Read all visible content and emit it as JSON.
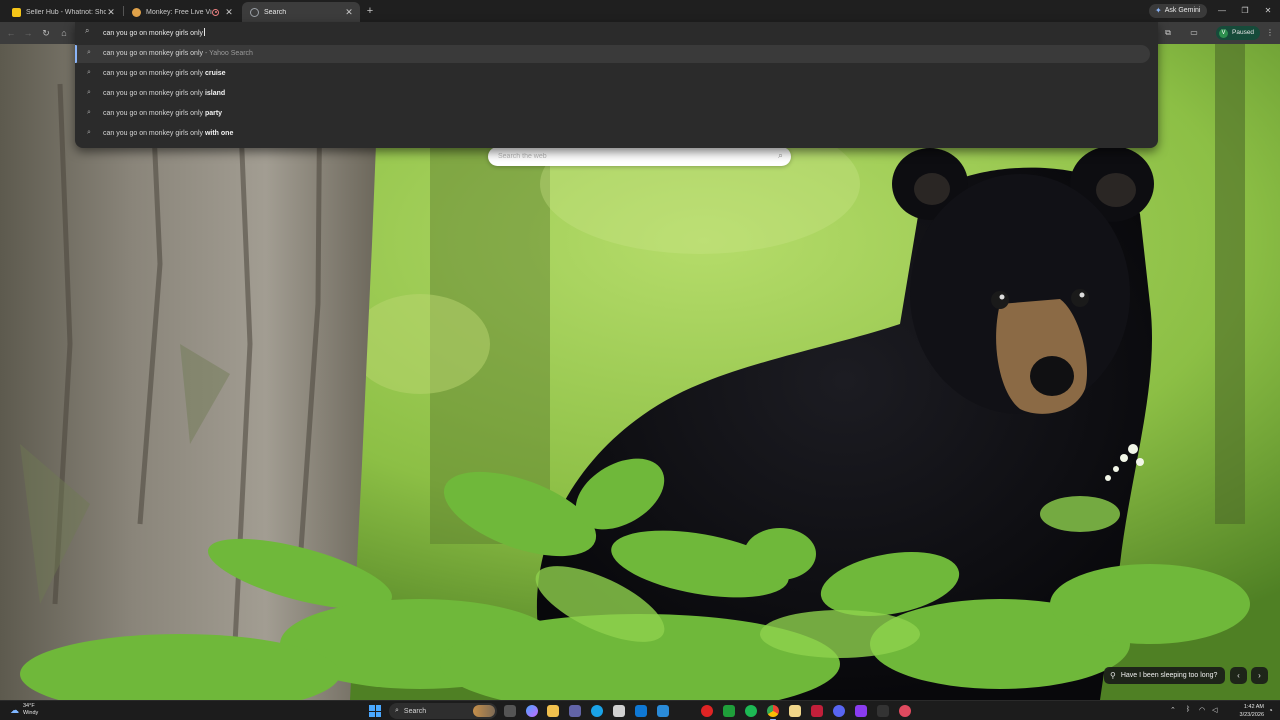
{
  "browser": {
    "tabs": [
      {
        "title": "Seller Hub - Whatnot: Shop, Sell",
        "favicon": "whatnot-icon",
        "color": "#f5c518",
        "active": false,
        "recording": false
      },
      {
        "title": "Monkey: Free Live Video Chat",
        "favicon": "monkey-icon",
        "color": "#e0a24a",
        "active": false,
        "recording": true
      },
      {
        "title": "Search",
        "favicon": "globe-icon",
        "color": "#9aa0a6",
        "active": true,
        "recording": false
      }
    ],
    "new_tab_label": "+",
    "gemini_label": "Ask Gemini",
    "profile_initial": "V",
    "profile_status": "Paused"
  },
  "omnibox": {
    "query": "can you go on monkey girls only",
    "suggestions": [
      {
        "base": "can you go on monkey girls only",
        "bold": "",
        "source": " - Yahoo Search",
        "selected": true
      },
      {
        "base": "can you go on monkey girls only ",
        "bold": "cruise",
        "source": "",
        "selected": false
      },
      {
        "base": "can you go on monkey girls only ",
        "bold": "island",
        "source": "",
        "selected": false
      },
      {
        "base": "can you go on monkey girls only ",
        "bold": "party",
        "source": "",
        "selected": false
      },
      {
        "base": "can you go on monkey girls only ",
        "bold": "with one",
        "source": "",
        "selected": false
      }
    ]
  },
  "newtab_page": {
    "search_placeholder": "Search the web",
    "photo_caption": "Have I been sleeping too long?"
  },
  "taskbar": {
    "temperature": "34°F",
    "condition": "Windy",
    "search_label": "Search",
    "time": "1:42 AM",
    "date": "3/23/2026"
  },
  "colors": {
    "accent": "#8ab4f8",
    "profile_bg": "#164b3a"
  }
}
